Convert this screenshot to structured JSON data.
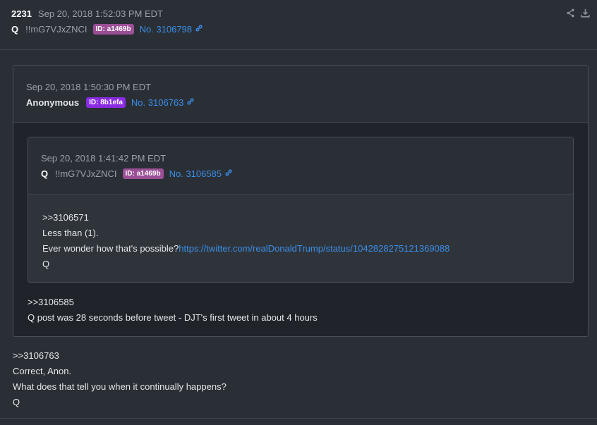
{
  "post": {
    "number": "2231",
    "date": "Sep 20, 2018 1:52:03 PM EDT",
    "name": "Q",
    "tripcode": "!!mG7VJxZNCI",
    "id_badge": "ID: a1469b",
    "id_color": "#9b4f96",
    "post_no": "No. 3106798",
    "body": [
      ">>3106763",
      "Correct, Anon.",
      "What does that tell you when it continually happens?",
      "Q"
    ]
  },
  "icons": {
    "share": "share-icon",
    "download": "download-icon",
    "link": "link-icon"
  },
  "quote1": {
    "date": "Sep 20, 2018 1:50:30 PM EDT",
    "name": "Anonymous",
    "id_badge": "ID: 8b1efa",
    "id_color": "#8a2be2",
    "post_no": "No. 3106763",
    "body": [
      ">>3106585",
      "Q post was 28 seconds before tweet - DJT's first tweet in about 4 hours"
    ]
  },
  "quote2": {
    "date": "Sep 20, 2018 1:41:42 PM EDT",
    "name": "Q",
    "tripcode": "!!mG7VJxZNCI",
    "id_badge": "ID: a1469b",
    "id_color": "#9b4f96",
    "post_no": "No. 3106585",
    "body_1": ">>3106571",
    "body_2": "Less than (1).",
    "body_3_text": "Ever wonder how that's possible?",
    "body_3_link": "https://twitter.com/realDonaldTrump/status/1042828275121369088",
    "body_4": "Q"
  },
  "colors": {
    "background": "#2a2f36",
    "link": "#3a8ee6"
  }
}
